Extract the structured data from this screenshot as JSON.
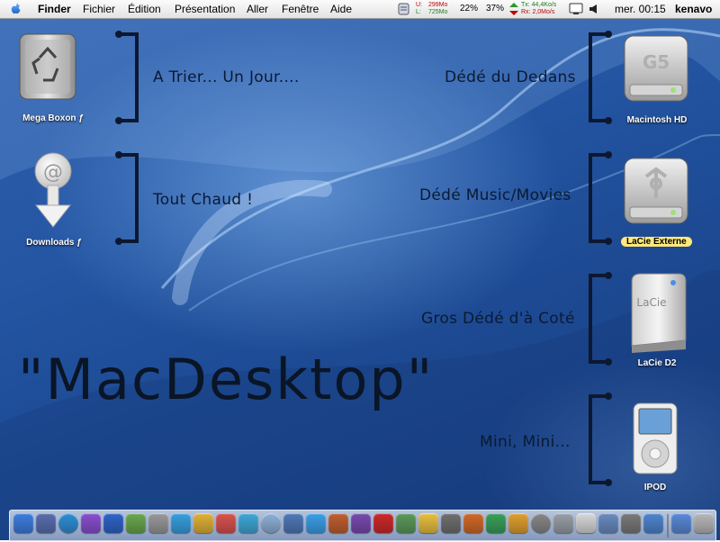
{
  "menubar": {
    "app_name": "Finder",
    "menus": [
      "Fichier",
      "Édition",
      "Présentation",
      "Aller",
      "Fenêtre",
      "Aide"
    ],
    "mem_u_label": "U:",
    "mem_u": "299Mo",
    "mem_l_label": "L:",
    "mem_l": "725Mo",
    "cpu1": "22%",
    "cpu2": "37%",
    "net_tx": "Tx: 44,4Ko/s",
    "net_rx": "Rx: 2,0Mo/s",
    "clock": "mer. 00:15",
    "user": "kenavo"
  },
  "desktop": {
    "title": "\"MacDesktop\"",
    "labels_left": [
      "A Trier... Un Jour....",
      "Tout Chaud !"
    ],
    "labels_right": [
      "Dédé du Dedans",
      "Dédé Music/Movies",
      "Gros Dédé d'à Coté",
      "Mini, Mini..."
    ],
    "icons": {
      "mega_boxon": "Mega Boxon ƒ",
      "downloads": "Downloads ƒ",
      "macintosh_hd": "Macintosh HD",
      "lacie_externe": "LaCie Externe",
      "lacie_d2": "LaCie D2",
      "ipod": "IPOD"
    },
    "hd_badge": "G5",
    "lacie_badge": "LaCie",
    "downloads_symbol": "@"
  },
  "dock": {
    "icons": [
      "finder-icon",
      "dashboard-icon",
      "safari-icon",
      "purple-app-icon",
      "word-icon",
      "pencil-icon",
      "tool-icon",
      "msn-icon",
      "ichat-icon",
      "ical-icon",
      "itunes-icon",
      "weather-icon",
      "iphoto-icon",
      "preview-icon",
      "icolor-icon",
      "game-icon",
      "magnet-icon",
      "grid-icon",
      "popcorn-icon",
      "calculator-icon",
      "chess-icon",
      "phone-icon",
      "widget-icon",
      "aperture-icon",
      "apple-icon",
      "notes-icon",
      "photo-icon",
      "system-prefs-icon",
      "apps-folder-icon",
      "documents-folder-icon",
      "trash-icon"
    ]
  },
  "colors": {
    "desktop_dark": "#163c7e",
    "desktop_mid": "#2456a4",
    "label_text": "#0b1a33",
    "selection": "#ffe97a"
  }
}
